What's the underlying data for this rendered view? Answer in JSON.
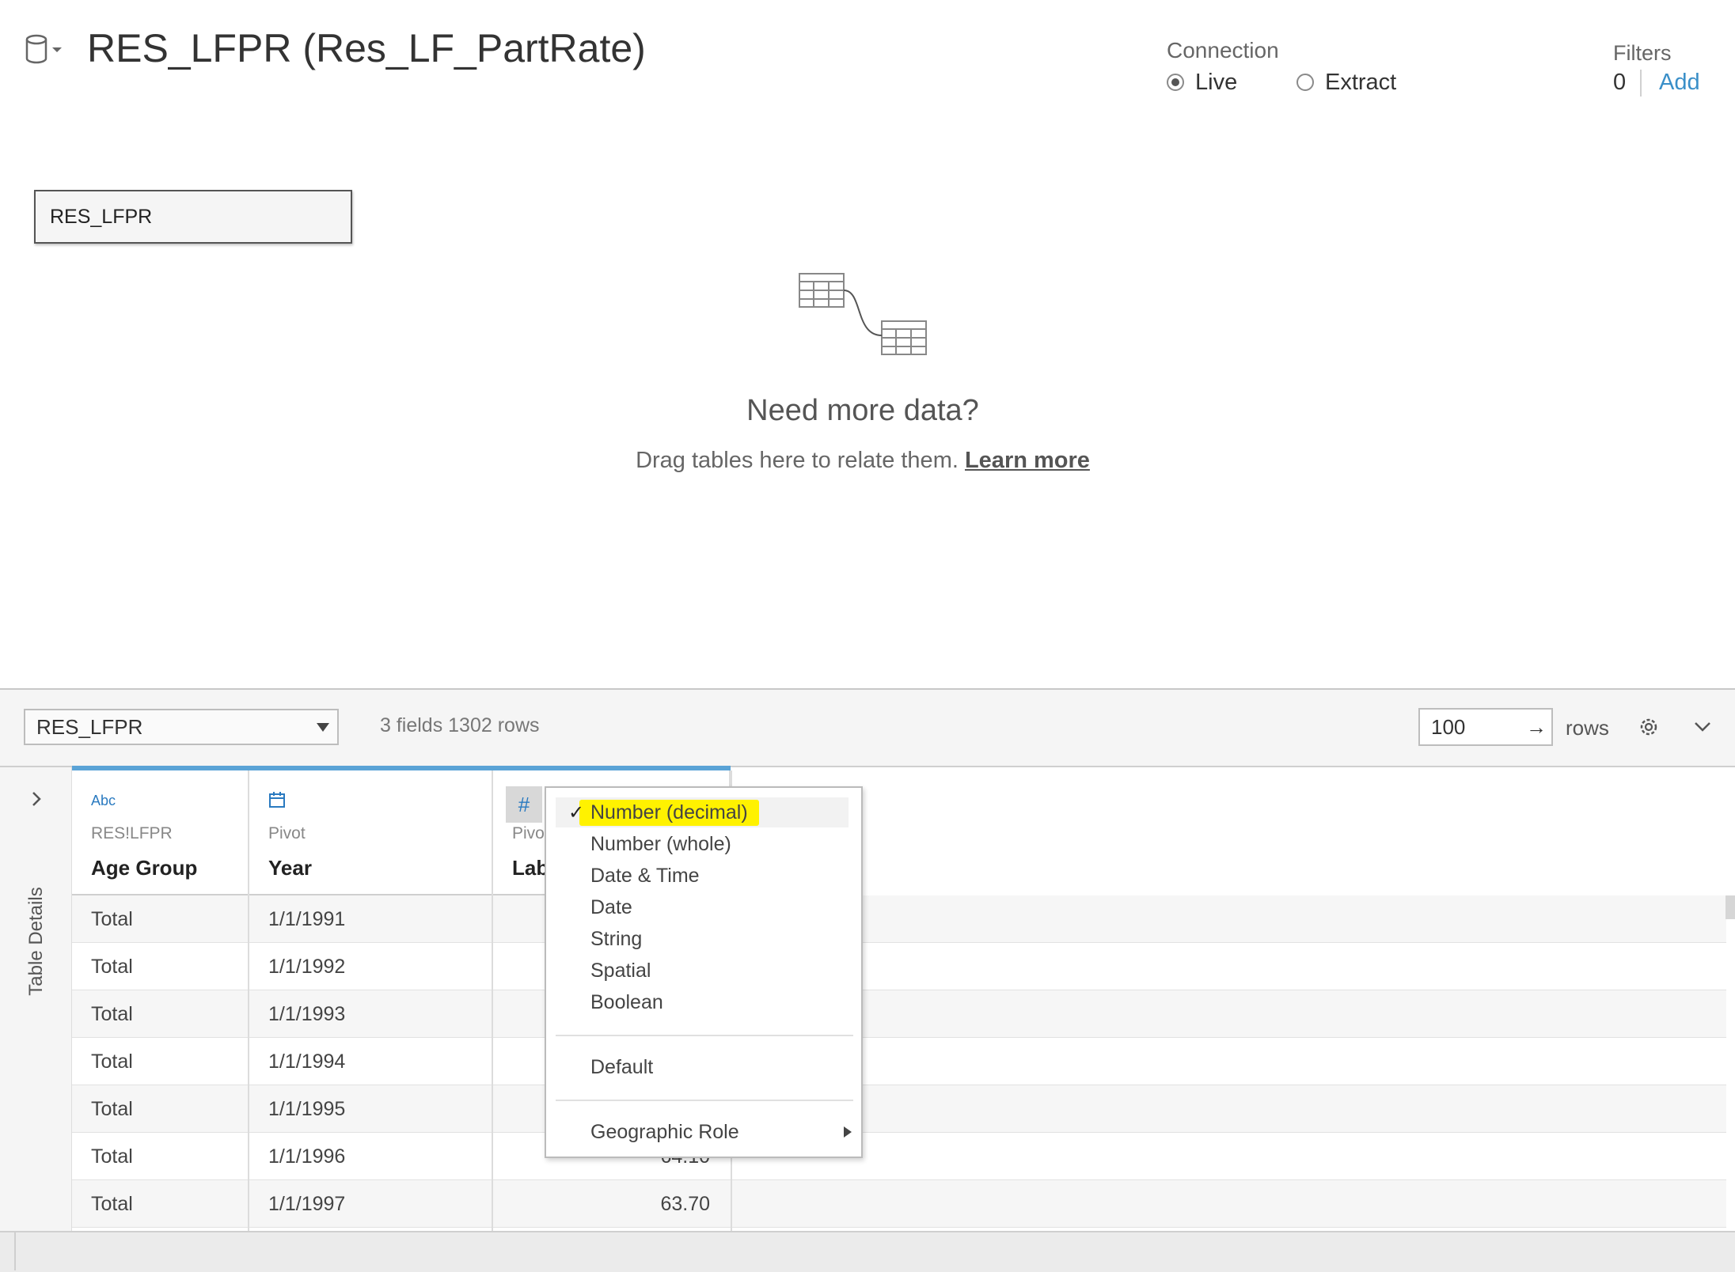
{
  "header": {
    "title": "RES_LFPR (Res_LF_PartRate)",
    "connection": {
      "label": "Connection",
      "options": [
        "Live",
        "Extract"
      ],
      "selected": "Live"
    },
    "filters": {
      "label": "Filters",
      "count": "0",
      "add_label": "Add"
    }
  },
  "canvas": {
    "table_card": "RES_LFPR",
    "need_more": "Need more data?",
    "drag_text": "Drag tables here to relate them.",
    "learn_more": "Learn more"
  },
  "grid_toolbar": {
    "table_select": "RES_LFPR",
    "fields_info": "3 fields 1302 rows",
    "rows_value": "100",
    "rows_arrow": "→",
    "rows_label": "rows"
  },
  "side_panel": {
    "label": "Table Details"
  },
  "columns": [
    {
      "type": "Abc",
      "source": "RES!LFPR",
      "name": "Age Group"
    },
    {
      "type": "date-icon",
      "source": "Pivot",
      "name": "Year"
    },
    {
      "type": "#",
      "source": "Pivo",
      "name": "Lab"
    }
  ],
  "rows": [
    {
      "age": "Total",
      "year": "1/1/1991",
      "value": ""
    },
    {
      "age": "Total",
      "year": "1/1/1992",
      "value": ""
    },
    {
      "age": "Total",
      "year": "1/1/1993",
      "value": ""
    },
    {
      "age": "Total",
      "year": "1/1/1994",
      "value": ""
    },
    {
      "age": "Total",
      "year": "1/1/1995",
      "value": ""
    },
    {
      "age": "Total",
      "year": "1/1/1996",
      "value": "64.10"
    },
    {
      "age": "Total",
      "year": "1/1/1997",
      "value": "63.70"
    }
  ],
  "type_menu": {
    "checkmark": "✓",
    "items": [
      "Number (decimal)",
      "Number (whole)",
      "Date & Time",
      "Date",
      "String",
      "Spatial",
      "Boolean"
    ],
    "selected": "Number (decimal)",
    "default_label": "Default",
    "geo_label": "Geographic Role"
  },
  "colors": {
    "accent": "#5aa3d6",
    "link": "#3a8fc8",
    "highlight": "#fff200"
  }
}
